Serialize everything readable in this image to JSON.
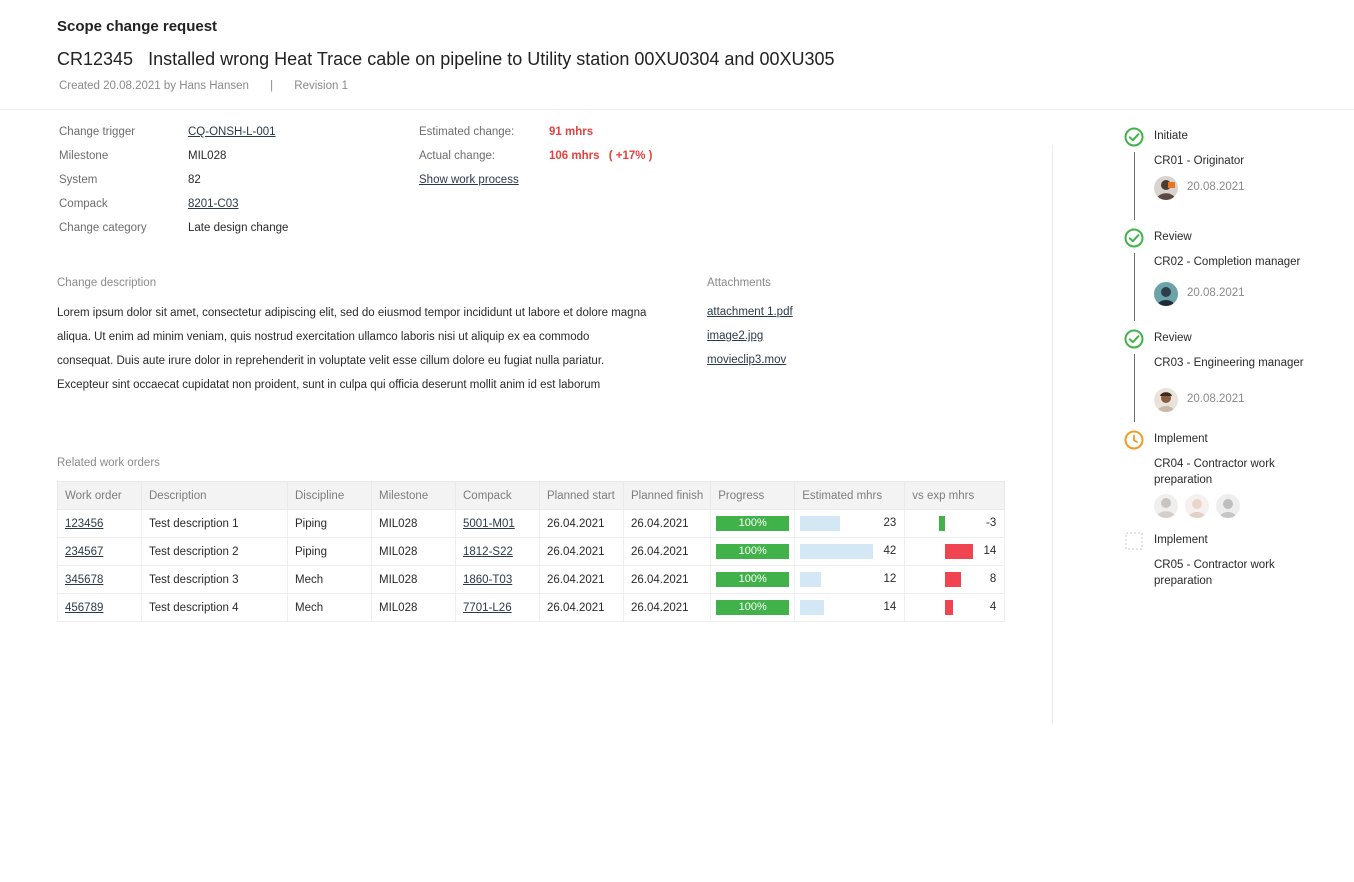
{
  "header": {
    "page_title": "Scope change request",
    "cr_id": "CR12345",
    "cr_title": "Installed wrong Heat Trace cable on pipeline to Utility station 00XU0304 and 00XU305",
    "created": "Created 20.08.2021 by Hans Hansen",
    "separator": "|",
    "revision": "Revision 1"
  },
  "info": {
    "change_trigger_label": "Change trigger",
    "change_trigger_value": "CQ-ONSH-L-001",
    "milestone_label": "Milestone",
    "milestone_value": "MIL028",
    "system_label": "System",
    "system_value": "82",
    "compack_label": "Compack",
    "compack_value": "8201-C03",
    "category_label": "Change category",
    "category_value": "Late design change",
    "estimated_label": "Estimated change:",
    "estimated_value": "91 mhrs",
    "actual_label": "Actual change:",
    "actual_value": "106 mhrs",
    "actual_delta": "( +17% )",
    "work_process_link": "Show work process"
  },
  "description": {
    "label": "Change description",
    "text": "Lorem ipsum dolor sit amet, consectetur adipiscing elit, sed do eiusmod tempor incididunt ut labore et dolore magna aliqua. Ut enim ad minim veniam, quis nostrud exercitation ullamco laboris nisi ut aliquip ex ea commodo consequat. Duis aute irure dolor in reprehenderit in voluptate velit esse cillum dolore eu fugiat nulla pariatur. Excepteur sint occaecat cupidatat non proident, sunt in culpa qui officia deserunt mollit anim id est laborum"
  },
  "attachments": {
    "label": "Attachments",
    "files": [
      "attachment 1.pdf",
      "image2.jpg",
      "movieclip3.mov"
    ]
  },
  "work_orders": {
    "label": "Related work orders",
    "columns": [
      "Work order",
      "Description",
      "Discipline",
      "Milestone",
      "Compack",
      "Planned start",
      "Planned finish",
      "Progress",
      "Estimated mhrs",
      "vs exp mhrs"
    ],
    "rows": [
      {
        "work_order": "123456",
        "description": "Test description 1",
        "discipline": "Piping",
        "milestone": "MIL028",
        "compack": "5001-M01",
        "planned_start": "26.04.2021",
        "planned_finish": "26.04.2021",
        "progress": "100%",
        "progress_value": 1.0,
        "estimated": "23",
        "estimated_value": 23,
        "vs_exp": "-3",
        "vs_exp_value": -3
      },
      {
        "work_order": "234567",
        "description": "Test description 2",
        "discipline": "Piping",
        "milestone": "MIL028",
        "compack": "1812-S22",
        "planned_start": "26.04.2021",
        "planned_finish": "26.04.2021",
        "progress": "100%",
        "progress_value": 1.0,
        "estimated": "42",
        "estimated_value": 42,
        "vs_exp": "14",
        "vs_exp_value": 14
      },
      {
        "work_order": "345678",
        "description": "Test description 3",
        "discipline": "Mech",
        "milestone": "MIL028",
        "compack": "1860-T03",
        "planned_start": "26.04.2021",
        "planned_finish": "26.04.2021",
        "progress": "100%",
        "progress_value": 1.0,
        "estimated": "12",
        "estimated_value": 12,
        "vs_exp": "8",
        "vs_exp_value": 8
      },
      {
        "work_order": "456789",
        "description": "Test description 4",
        "discipline": "Mech",
        "milestone": "MIL028",
        "compack": "7701-L26",
        "planned_start": "26.04.2021",
        "planned_finish": "26.04.2021",
        "progress": "100%",
        "progress_value": 1.0,
        "estimated": "14",
        "estimated_value": 14,
        "vs_exp": "4",
        "vs_exp_value": 4
      }
    ]
  },
  "workflow": [
    {
      "title": "Initiate",
      "role": "CR01 - Originator",
      "date": "20.08.2021",
      "status": "done",
      "icon": "check-circle-icon"
    },
    {
      "title": "Review",
      "role": "CR02 - Completion manager",
      "date": "20.08.2021",
      "status": "done",
      "icon": "check-circle-icon"
    },
    {
      "title": "Review",
      "role": "CR03 - Engineering manager",
      "date": "20.08.2021",
      "status": "done",
      "icon": "check-circle-icon"
    },
    {
      "title": "Implement",
      "role": "CR04 - Contractor work preparation",
      "status": "in-progress",
      "icon": "clock-icon"
    },
    {
      "title": "Implement",
      "role": "CR05 - Contractor work preparation",
      "status": "pending",
      "icon": "dashed-square-icon"
    }
  ],
  "colors": {
    "done": "#41b24a",
    "in_progress": "#f39c1f",
    "red": "#e8403c",
    "progress_green": "#41b24a",
    "estimate_bar": "#d3e7f5",
    "vs_positive": "#f04450",
    "vs_negative": "#41b24a"
  }
}
